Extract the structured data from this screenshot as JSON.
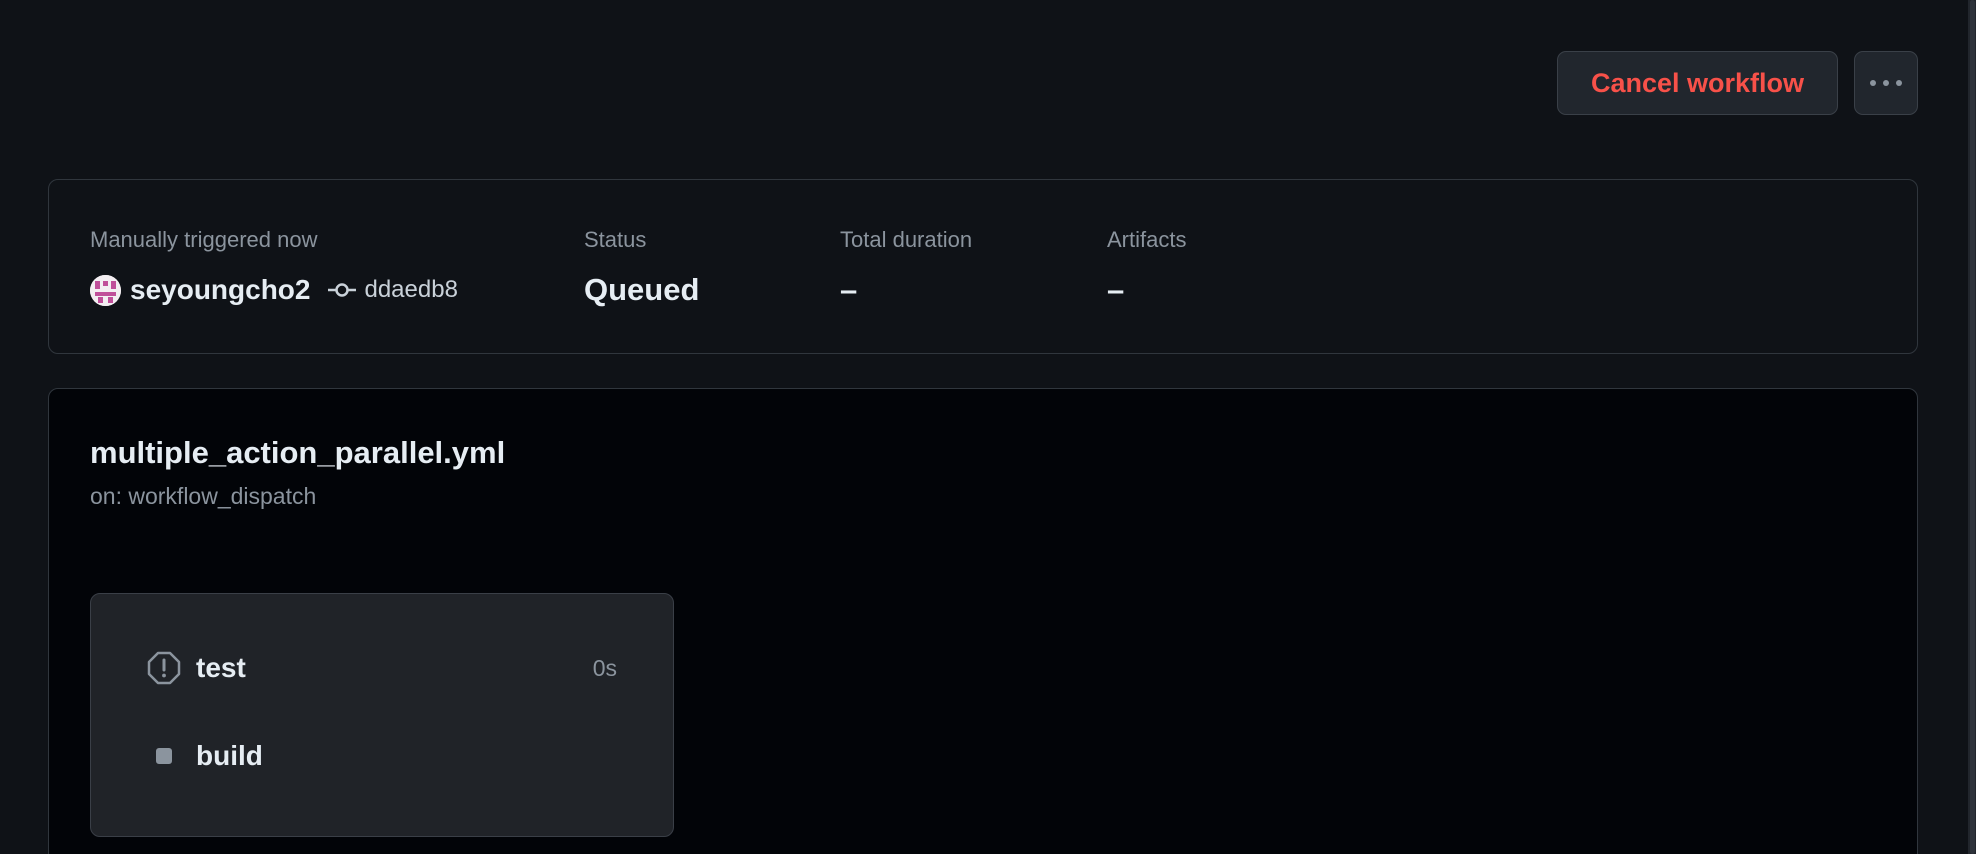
{
  "header": {
    "cancel_label": "Cancel workflow",
    "more_icon": "kebab-horizontal-icon"
  },
  "summary": {
    "trigger_label": "Manually triggered now",
    "actor": "seyoungcho2",
    "commit_sha": "ddaedb8",
    "status_label": "Status",
    "status_value": "Queued",
    "duration_label": "Total duration",
    "duration_value": "–",
    "artifacts_label": "Artifacts",
    "artifacts_value": "–"
  },
  "workflow": {
    "file_name": "multiple_action_parallel.yml",
    "trigger": "on: workflow_dispatch",
    "jobs": [
      {
        "name": "test",
        "time": "0s",
        "icon": "alert-octagon-icon"
      },
      {
        "name": "build",
        "time": "",
        "icon": "queued-square-icon"
      }
    ]
  },
  "colors": {
    "danger": "#f85149",
    "background": "#0f1217",
    "panel": "#020408",
    "card": "#202328",
    "border": "#30363d"
  }
}
